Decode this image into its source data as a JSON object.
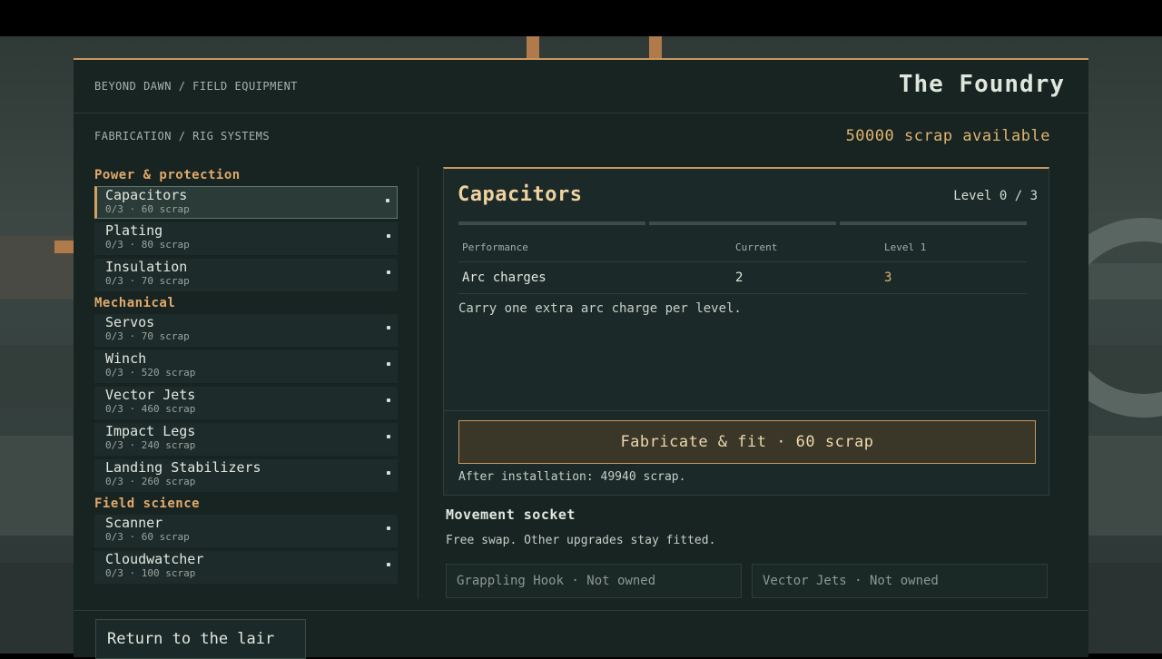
{
  "header": {
    "breadcrumb": "BEYOND DAWN / FIELD EQUIPMENT",
    "title": "The Foundry",
    "sub_breadcrumb": "FABRICATION / RIG SYSTEMS",
    "scrap_available": "50000 scrap available"
  },
  "categories": [
    {
      "label": "Power & protection",
      "items": [
        {
          "name": "Capacitors",
          "meta": "0/3 · 60 scrap",
          "selected": true
        },
        {
          "name": "Plating",
          "meta": "0/3 · 80 scrap"
        },
        {
          "name": "Insulation",
          "meta": "0/3 · 70 scrap"
        }
      ]
    },
    {
      "label": "Mechanical",
      "items": [
        {
          "name": "Servos",
          "meta": "0/3 · 70 scrap"
        },
        {
          "name": "Winch",
          "meta": "0/3 · 520 scrap"
        },
        {
          "name": "Vector Jets",
          "meta": "0/3 · 460 scrap"
        },
        {
          "name": "Impact Legs",
          "meta": "0/3 · 240 scrap"
        },
        {
          "name": "Landing Stabilizers",
          "meta": "0/3 · 260 scrap"
        }
      ]
    },
    {
      "label": "Field science",
      "items": [
        {
          "name": "Scanner",
          "meta": "0/3 · 60 scrap"
        },
        {
          "name": "Cloudwatcher",
          "meta": "0/3 · 100 scrap"
        }
      ]
    }
  ],
  "detail": {
    "name": "Capacitors",
    "level": "Level 0 / 3",
    "level_current": 0,
    "level_max": 3,
    "table": {
      "headers": [
        "Performance",
        "Current",
        "Level 1"
      ],
      "rows": [
        [
          "Arc charges",
          "2",
          "3"
        ]
      ]
    },
    "description": "Carry one extra arc charge per level.",
    "fabricate_label": "Fabricate & fit · 60 scrap",
    "after_install": "After installation: 49940 scrap."
  },
  "socket": {
    "title": "Movement socket",
    "description": "Free swap. Other upgrades stay fitted.",
    "slots": [
      "Grappling Hook · Not owned",
      "Vector Jets · Not owned"
    ]
  },
  "footer": {
    "return_label": "Return to the lair"
  },
  "colors": {
    "accent": "#c9975c",
    "scrap": "#e1b36f",
    "panel": "#172422"
  }
}
